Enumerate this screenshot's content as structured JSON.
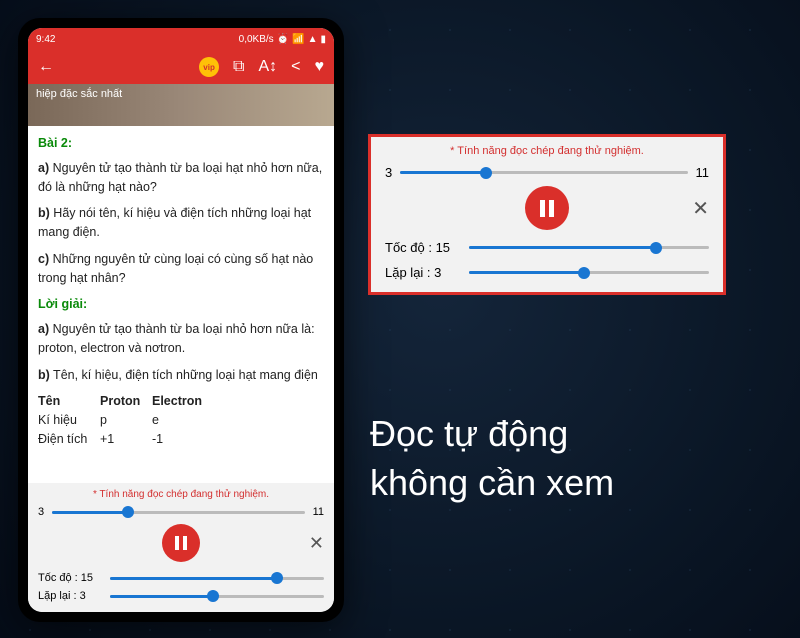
{
  "status": {
    "time": "9:42",
    "net": "0,0KB/s"
  },
  "banner": {
    "text": "hiệp đặc sắc nhất"
  },
  "lesson": {
    "bai": "Bài 2:",
    "qa": "a)",
    "qat": " Nguyên tử tạo thành từ ba loại hạt nhỏ hơn nữa, đó là những hạt nào?",
    "qb": "b)",
    "qbt": " Hãy nói tên, kí hiệu và điện tích những loại hạt mang điện.",
    "qc": "c)",
    "qct": " Những nguyên tử cùng loại có cùng số hạt nào trong hạt nhân?",
    "loigiai": "Lời giải:",
    "aa": "a)",
    "aat": " Nguyên tử tạo thành từ ba loại nhỏ hơn nữa là: proton, electron và nơtron.",
    "ab": "b)",
    "abt": " Tên, kí hiệu, điện tích những loại hạt mang điện",
    "table": {
      "h1": "Tên",
      "h2": "Proton",
      "h3": "Electron",
      "r1c1": "Kí hiệu",
      "r1c2": "p",
      "r1c3": "e",
      "r2c1": "Điện tích",
      "r2c2": "+1",
      "r2c3": "-1"
    }
  },
  "player": {
    "note": "* Tính năng đọc chép đang thử nghiệm.",
    "start": "3",
    "end": "11",
    "speed_lbl": "Tốc độ : 15",
    "repeat_lbl": "Lặp lại : 3",
    "progress_pct": 30,
    "speed_pct": 78,
    "repeat_pct": 48
  },
  "headline": {
    "l1": "Đọc tự động",
    "l2": "không cần xem"
  }
}
